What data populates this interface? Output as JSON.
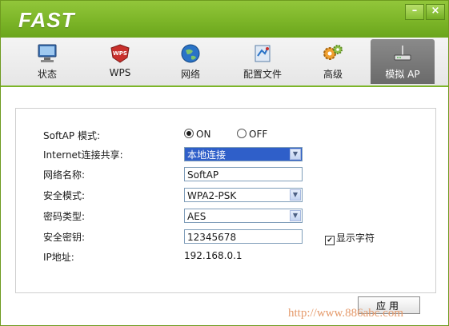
{
  "window": {
    "logo": "FAST",
    "min_glyph": "–",
    "close_glyph": "×"
  },
  "nav": {
    "tabs": [
      {
        "label": "状态",
        "icon": "monitor-icon"
      },
      {
        "label": "WPS",
        "icon": "wps-shield-icon"
      },
      {
        "label": "网络",
        "icon": "globe-icon"
      },
      {
        "label": "配置文件",
        "icon": "profile-icon"
      },
      {
        "label": "高级",
        "icon": "gears-icon"
      },
      {
        "label": "模拟 AP",
        "icon": "router-icon",
        "active": true
      }
    ]
  },
  "form": {
    "softap_mode": {
      "label": "SoftAP 模式:",
      "on": "ON",
      "off": "OFF",
      "selected": "ON"
    },
    "internet_share": {
      "label": "Internet连接共享:",
      "value": "本地连接"
    },
    "network_name": {
      "label": "网络名称:",
      "value": "SoftAP"
    },
    "security_mode": {
      "label": "安全模式:",
      "value": "WPA2-PSK"
    },
    "cipher_type": {
      "label": "密码类型:",
      "value": "AES"
    },
    "security_key": {
      "label": "安全密钥:",
      "value": "12345678"
    },
    "show_chars": {
      "label": "显示字符",
      "checked": true
    },
    "ip_address": {
      "label": "IP地址:",
      "value": "192.168.0.1"
    }
  },
  "buttons": {
    "apply": "应用"
  },
  "watermark": "http://www.886abc.com",
  "colors": {
    "brand_green": "#7cb528",
    "active_tab": "#777777",
    "selection_blue": "#2f5fc9"
  }
}
